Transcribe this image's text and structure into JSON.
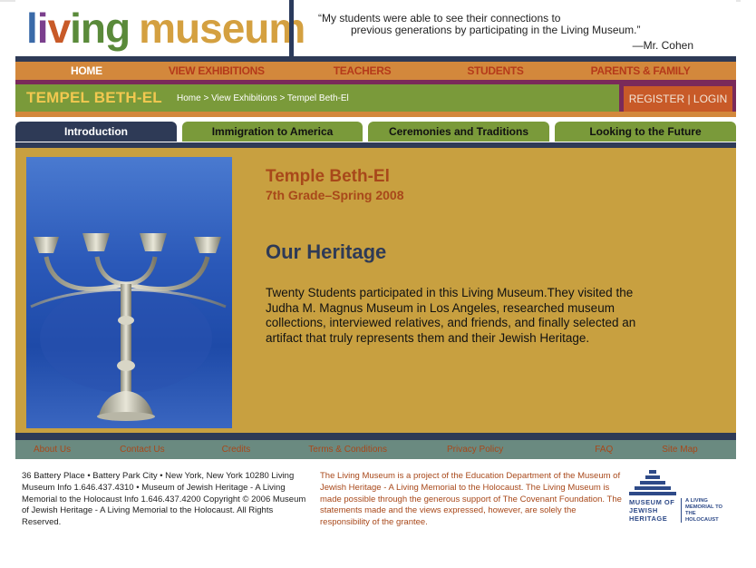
{
  "header": {
    "logo_parts": [
      "l",
      "i",
      "v",
      "ing"
    ],
    "logo_word1": "living",
    "logo_word2": "museum",
    "quote_line1": "“My students were able to see their connections to",
    "quote_line2": "previous generations by participating in the Living Museum.”",
    "quote_author": "—Mr. Cohen"
  },
  "nav": {
    "items": [
      {
        "label": "HOME",
        "active": true
      },
      {
        "label": "VIEW EXHIBITIONS",
        "active": false
      },
      {
        "label": "TEACHERS",
        "active": false
      },
      {
        "label": "STUDENTS",
        "active": false
      },
      {
        "label": "PARENTS & FAMILY",
        "active": false
      }
    ]
  },
  "section": {
    "title": "TEMPEL BETH-EL",
    "breadcrumb": "Home > View Exhibitions > Tempel Beth-El",
    "register_login": "REGISTER | LOGIN"
  },
  "tabs": [
    {
      "label": "Introduction",
      "active": true
    },
    {
      "label": "Immigration to America",
      "active": false
    },
    {
      "label": "Ceremonies and Traditions",
      "active": false
    },
    {
      "label": "Looking to the Future",
      "active": false
    }
  ],
  "content": {
    "title": "Temple Beth-El",
    "subtitle": "7th Grade–Spring 2008",
    "heading": "Our Heritage",
    "body": "Twenty Students participated in this Living Museum.They visited the Judha M. Magnus Museum in Los Angeles, researched museum collections, interviewed relatives, and friends, and finally selected an artifact that truly represents them and their Jewish Heritage."
  },
  "footer_nav": [
    "About Us",
    "Contact Us",
    "Credits",
    "Terms & Conditions",
    "Privacy Policy",
    "FAQ",
    "Site Map"
  ],
  "footer": {
    "address": "36 Battery Place • Battery Park City • New York, New York 10280 Living Museum Info 1.646.437.4310 • Museum of Jewish Heritage - A Living Memorial to the Holocaust Info 1.646.437.4200 Copyright © 2006 Museum of Jewish Heritage - A Living Memorial to the Holocaust. All Rights Reserved.",
    "project": "The Living Museum is a project of the Education Department of the Museum of Jewish Heritage - A Living Memorial to the Holocaust. The Living Museum is made possible through the generous support of The Covenant Foundation. The statements made and the views expressed, however, are solely the responsibility of the grantee.",
    "mjh_name": "MUSEUM OF JEWISH HERITAGE",
    "mjh_tagline": "A LIVING MEMORIAL TO THE HOLOCAUST"
  },
  "colors": {
    "navy": "#2e3a56",
    "orange": "#d3883c",
    "olive": "#7a9a3a",
    "gold": "#c8a040",
    "rust": "#a8481a",
    "plum": "#7a2a5a"
  }
}
